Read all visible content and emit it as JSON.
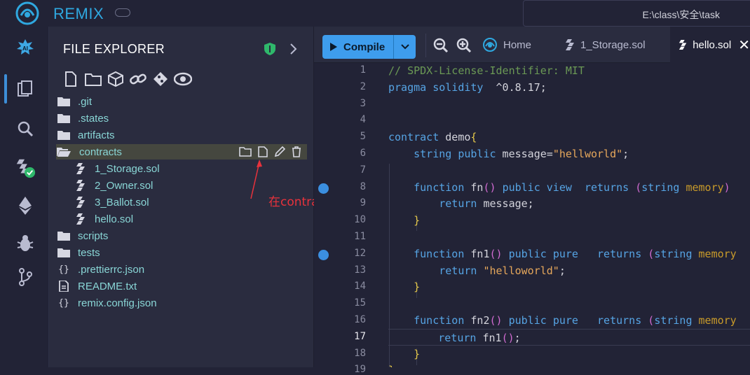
{
  "app": {
    "title": "REMIX",
    "path": "E:\\class\\安全\\task"
  },
  "iconbar": {
    "items": [
      "ai-icon",
      "files-icon",
      "search-icon",
      "solidity-compiler-icon",
      "deploy-icon",
      "debug-icon",
      "git-icon"
    ]
  },
  "explorer": {
    "title": "FILE EXPLORER",
    "tools": [
      "new-file-icon",
      "new-folder-icon",
      "cube-icon",
      "link-icon",
      "git-diamond-icon",
      "eye-icon"
    ],
    "tree": [
      {
        "label": ".git",
        "type": "folder",
        "child": false
      },
      {
        "label": ".states",
        "type": "folder",
        "child": false
      },
      {
        "label": "artifacts",
        "type": "folder",
        "child": false
      },
      {
        "label": "contracts",
        "type": "folder-open",
        "child": false,
        "selected": true
      },
      {
        "label": "1_Storage.sol",
        "type": "sol",
        "child": true
      },
      {
        "label": "2_Owner.sol",
        "type": "sol",
        "child": true
      },
      {
        "label": "3_Ballot.sol",
        "type": "sol",
        "child": true
      },
      {
        "label": "hello.sol",
        "type": "sol",
        "child": true
      },
      {
        "label": "scripts",
        "type": "folder",
        "child": false
      },
      {
        "label": "tests",
        "type": "folder",
        "child": false
      },
      {
        "label": ".prettierrc.json",
        "type": "json",
        "child": false
      },
      {
        "label": "README.txt",
        "type": "txt",
        "child": false
      },
      {
        "label": "remix.config.json",
        "type": "json",
        "child": false
      }
    ],
    "annotation": "在contracts里面创建一个hello.sol文件"
  },
  "editor": {
    "compile_label": "Compile",
    "tabs": [
      {
        "label": "Home",
        "active": false
      },
      {
        "label": "1_Storage.sol",
        "active": false
      },
      {
        "label": "hello.sol",
        "active": true
      }
    ],
    "lines": [
      {
        "n": "1",
        "text": "// SPDX-License-Identifier: MIT"
      },
      {
        "n": "2",
        "text": "pragma solidity  ^0.8.17;"
      },
      {
        "n": "3",
        "text": ""
      },
      {
        "n": "4",
        "text": ""
      },
      {
        "n": "5",
        "text": "contract demo{"
      },
      {
        "n": "6",
        "text": "    string public message=\"hellworld\";"
      },
      {
        "n": "7",
        "text": ""
      },
      {
        "n": "8",
        "text": "    function fn() public view  returns (string memory)"
      },
      {
        "n": "9",
        "text": "        return message;"
      },
      {
        "n": "10",
        "text": "    }"
      },
      {
        "n": "11",
        "text": ""
      },
      {
        "n": "12",
        "text": "    function fn1() public pure   returns (string memory"
      },
      {
        "n": "13",
        "text": "        return \"helloworld\";"
      },
      {
        "n": "14",
        "text": "    }"
      },
      {
        "n": "15",
        "text": ""
      },
      {
        "n": "16",
        "text": "    function fn2() public pure   returns (string memory"
      },
      {
        "n": "17",
        "text": "        return fn1();"
      },
      {
        "n": "18",
        "text": "    }"
      },
      {
        "n": "19",
        "text": "}"
      }
    ],
    "current_line": "17",
    "breakpoint_lines": [
      "8",
      "12"
    ]
  },
  "colors": {
    "accent": "#3e9ded",
    "annotation": "#e8323c",
    "background": "#222336",
    "panel": "#2a2c3f"
  }
}
